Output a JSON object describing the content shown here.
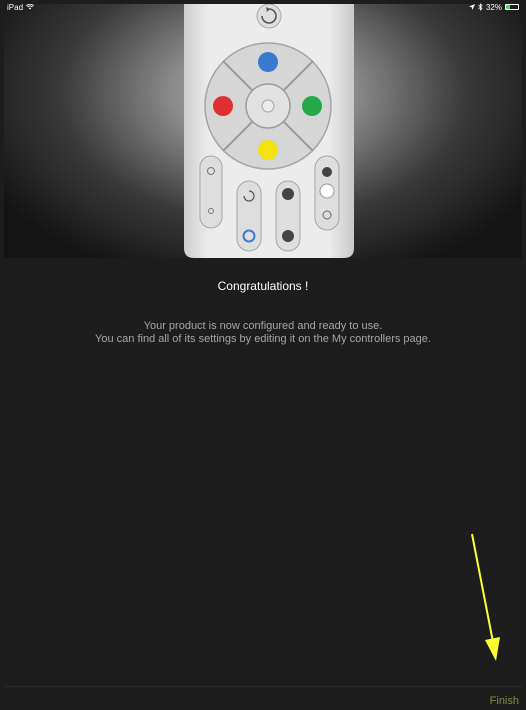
{
  "status_bar": {
    "device": "iPad",
    "battery_percent": "32%",
    "battery_level": 0.32
  },
  "main": {
    "title": "Congratulations !",
    "message_line1": "Your product is now configured and ready to use.",
    "message_line2": "You can find all of its settings by editing it on the My controllers page."
  },
  "footer": {
    "finish_label": "Finish"
  },
  "colors": {
    "background": "#1d1d1d",
    "finish_text": "#7d9138",
    "annotation_arrow": "#ffff33",
    "remote_blue": "#3a7ad0",
    "remote_red": "#e03131",
    "remote_green": "#23a84a",
    "remote_yellow": "#f3e311"
  }
}
